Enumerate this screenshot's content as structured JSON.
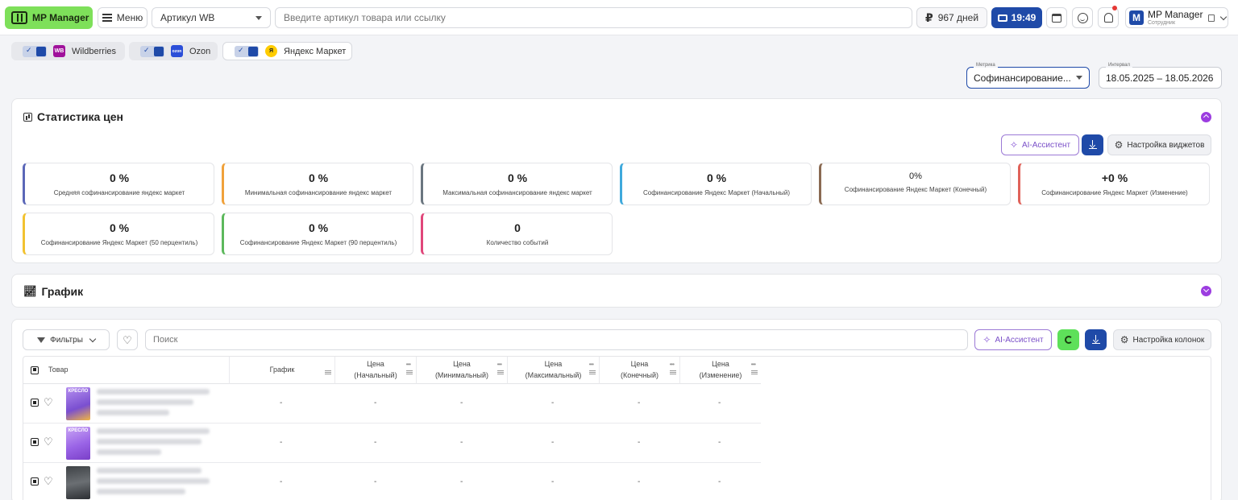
{
  "topbar": {
    "logo": "MP Manager",
    "menu": "Меню",
    "article_select": "Артикул WB",
    "search_placeholder": "Введите артикул товара или ссылку",
    "days": "967 дней",
    "ruble_sign": "₽",
    "time": "19:49",
    "account_name": "MP Manager",
    "account_role": "Сотрудник",
    "avatar_letter": "M"
  },
  "marketplaces": [
    {
      "name": "Wildberries",
      "active": true,
      "logo": "WB",
      "color": "#a0119b"
    },
    {
      "name": "Ozon",
      "active": true,
      "logo": "ozon",
      "color": "#2b4ed8"
    },
    {
      "name": "Яндекс Маркет",
      "active": false,
      "logo": "Я",
      "color": "#ffcc00"
    }
  ],
  "filters": {
    "metric_label": "Метрика",
    "metric_value": "Софинансирование...",
    "interval_label": "Интервал",
    "interval_value": "18.05.2025 – 18.05.2026"
  },
  "stats": {
    "title": "Статистика цен",
    "ai_button": "AI-Ассистент",
    "settings_button": "Настройка виджетов",
    "kpis": [
      {
        "value": "0 %",
        "label": "Средняя софинансирование яндекс маркет",
        "color": "#5b67b8"
      },
      {
        "value": "0 %",
        "label": "Минимальная софинансирование яндекс маркет",
        "color": "#f0a13a"
      },
      {
        "value": "0 %",
        "label": "Максимальная софинансирование яндекс маркет",
        "color": "#6b7680"
      },
      {
        "value": "0 %",
        "label": "Софинансирование Яндекс Маркет (Начальный)",
        "color": "#3fa9dc"
      },
      {
        "value": "0%",
        "label": "Софинансирование Яндекс Маркет (Конечный)",
        "color": "#8a6a52"
      },
      {
        "value": "+0 %",
        "label": "Софинансирование Яндекс Маркет (Изменение)",
        "color": "#e0625a"
      },
      {
        "value": "0 %",
        "label": "Софинансирование Яндекс Маркет (50 перцентиль)",
        "color": "#f2c230"
      },
      {
        "value": "0 %",
        "label": "Софинансирование Яндекс Маркет (90 перцентиль)",
        "color": "#5cb85c"
      },
      {
        "value": "0",
        "label": "Количество событий",
        "color": "#e0467a"
      }
    ]
  },
  "graph": {
    "title": "График"
  },
  "table": {
    "filters_button": "Фильтры",
    "search_placeholder": "Поиск",
    "ai_button": "AI-Ассистент",
    "settings_button": "Настройка колонок",
    "columns": {
      "product": "Товар",
      "chart": "График",
      "price_start_1": "Цена",
      "price_start_2": "(Начальный)",
      "price_min_1": "Цена",
      "price_min_2": "(Минимальный)",
      "price_max_1": "Цена",
      "price_max_2": "(Максимальный)",
      "price_end_1": "Цена",
      "price_end_2": "(Конечный)",
      "price_change_1": "Цена",
      "price_change_2": "(Изменение)"
    },
    "rows": [
      {
        "thumb_label": "КРЕСЛО",
        "thumb_color": "#8a5ad6",
        "cells": [
          "-",
          "-",
          "-",
          "-",
          "-",
          "-"
        ]
      },
      {
        "thumb_label": "КРЕСЛО",
        "thumb_color": "#a36ee6",
        "cells": [
          "-",
          "-",
          "-",
          "-",
          "-",
          "-"
        ]
      },
      {
        "thumb_label": "",
        "thumb_color": "#5a5e62",
        "cells": [
          "-",
          "-",
          "-",
          "-",
          "-",
          "-"
        ]
      }
    ]
  }
}
